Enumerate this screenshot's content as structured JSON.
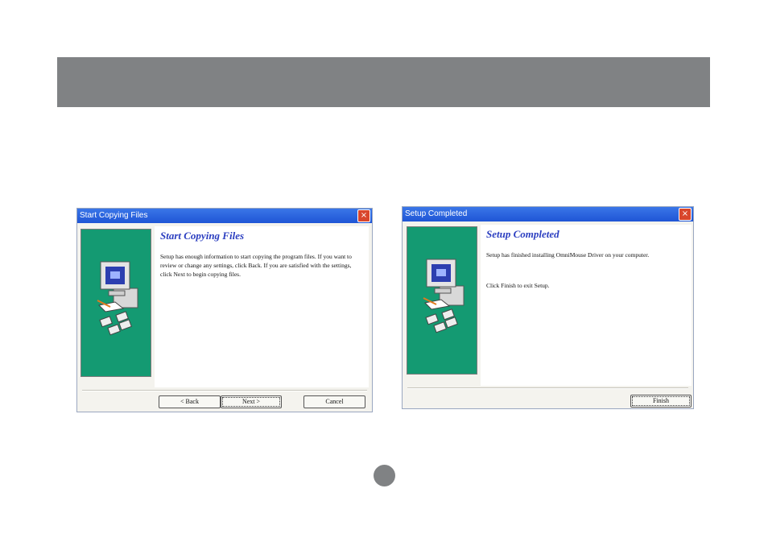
{
  "dialog_copy": {
    "title": "Start Copying Files",
    "heading": "Start Copying Files",
    "body": "Setup has enough information to start copying the program files.  If you want to review or change any settings, click Back.  If you are satisfied with the settings, click Next to begin copying files.",
    "back_label": "< Back",
    "next_label": "Next >",
    "cancel_label": "Cancel",
    "close_glyph": "×"
  },
  "dialog_complete": {
    "title": "Setup Completed",
    "heading": "Setup Completed",
    "body": "Setup has finished installing OmniMouse Driver on your computer.",
    "body2": "Click Finish to exit Setup.",
    "finish_label": "Finish",
    "close_glyph": "×"
  },
  "colors": {
    "header_band": "#808284",
    "titlebar": "#1f55d6",
    "side_panel": "#149a72",
    "heading": "#2b3ec0"
  }
}
